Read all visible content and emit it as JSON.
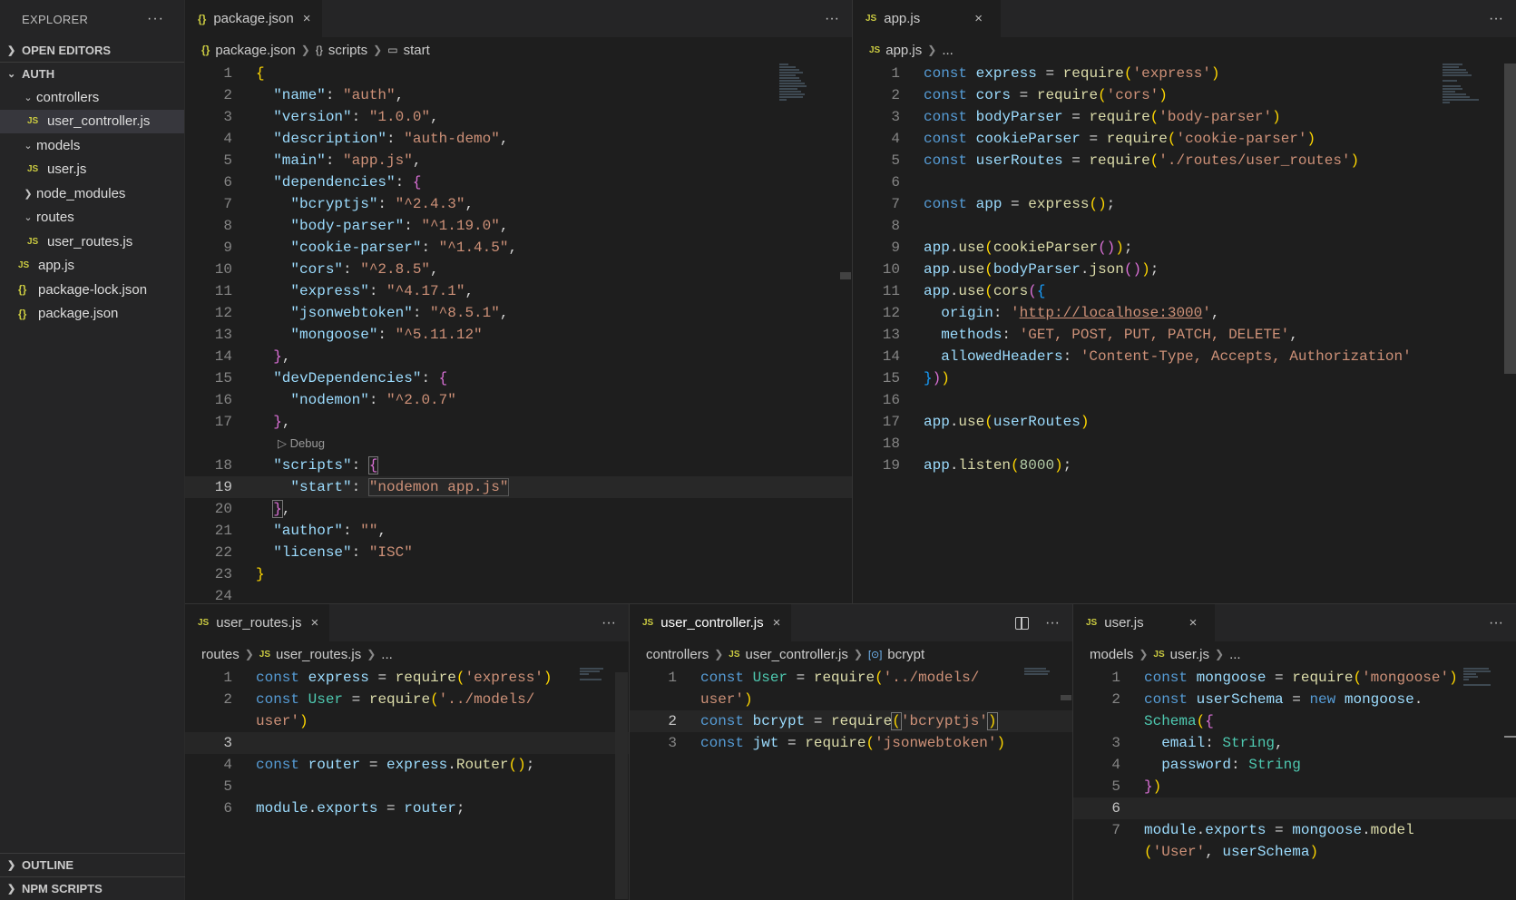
{
  "explorer": {
    "title": "EXPLORER",
    "more": "···",
    "open_editors": "OPEN EDITORS",
    "root": "AUTH",
    "tree": [
      {
        "label": "controllers"
      },
      {
        "label": "user_controller.js"
      },
      {
        "label": "models"
      },
      {
        "label": "user.js"
      },
      {
        "label": "node_modules"
      },
      {
        "label": "routes"
      },
      {
        "label": "user_routes.js"
      },
      {
        "label": "app.js"
      },
      {
        "label": "package-lock.json"
      },
      {
        "label": "package.json"
      }
    ],
    "outline": "OUTLINE",
    "npm_scripts": "NPM SCRIPTS"
  },
  "icons": {
    "js": "JS",
    "json": "{}",
    "close": "×",
    "chevron_right": "›",
    "chevron_down": "⌄",
    "debug": "▷"
  },
  "editors": {
    "package_json": {
      "tab": "package.json",
      "bc": [
        "package.json",
        "scripts",
        "start"
      ],
      "codelens": "Debug"
    },
    "app_js": {
      "tab": "app.js",
      "bc": [
        "app.js",
        "..."
      ]
    },
    "user_routes": {
      "tab": "user_routes.js",
      "bc": [
        "routes",
        "user_routes.js",
        "..."
      ]
    },
    "user_controller": {
      "tab": "user_controller.js",
      "bc": [
        "controllers",
        "user_controller.js",
        "bcrypt"
      ]
    },
    "user_js": {
      "tab": "user.js",
      "bc": [
        "models",
        "user.js",
        "..."
      ]
    }
  },
  "colors": {
    "background": "#1e1e1e",
    "sidebar": "#252526",
    "keyword": "#569cd6",
    "string": "#ce9178",
    "function": "#dcdcaa"
  }
}
